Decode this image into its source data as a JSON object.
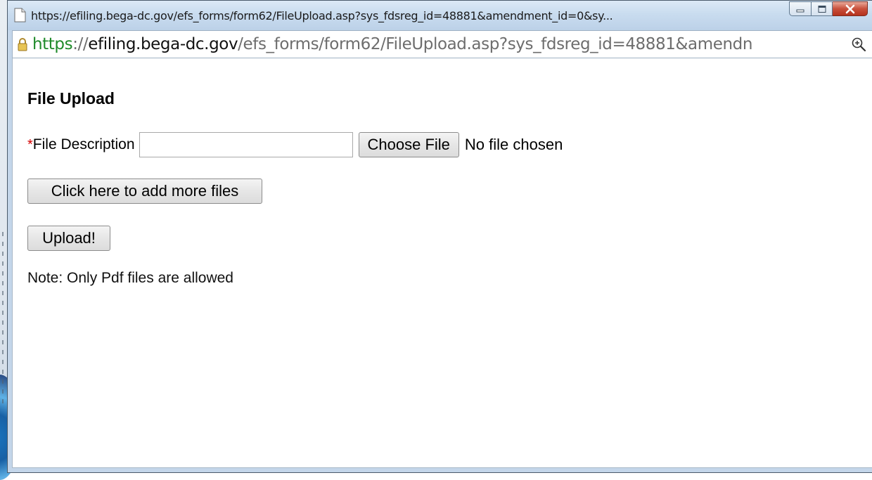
{
  "window": {
    "title": "https://efiling.bega-dc.gov/efs_forms/form62/FileUpload.asp?sys_fdsreg_id=48881&amendment_id=0&sy...",
    "title_icon": "page-icon",
    "buttons": {
      "minimize_icon": "minimize-icon",
      "maximize_icon": "maximize-icon",
      "close_icon": "close-icon"
    }
  },
  "address": {
    "lock_icon": "lock-icon",
    "scheme": "https",
    "sep": "://",
    "host": "efiling.bega-dc.gov",
    "path": "/efs_forms/form62/FileUpload.asp?sys_fdsreg_id=48881&amendn",
    "zoom_icon": "zoom-icon"
  },
  "form": {
    "title": "File Upload",
    "required_marker": "*",
    "description_label": "File Description",
    "description_value": "",
    "choose_file_label": "Choose File",
    "no_file_text": "No file chosen",
    "add_more_label": "Click here to add more files",
    "upload_label": "Upload!",
    "note": "Note: Only Pdf files are allowed"
  },
  "colors": {
    "required": "#d40000",
    "url_scheme": "#1f8a2a",
    "close_button": "#c9503b"
  }
}
